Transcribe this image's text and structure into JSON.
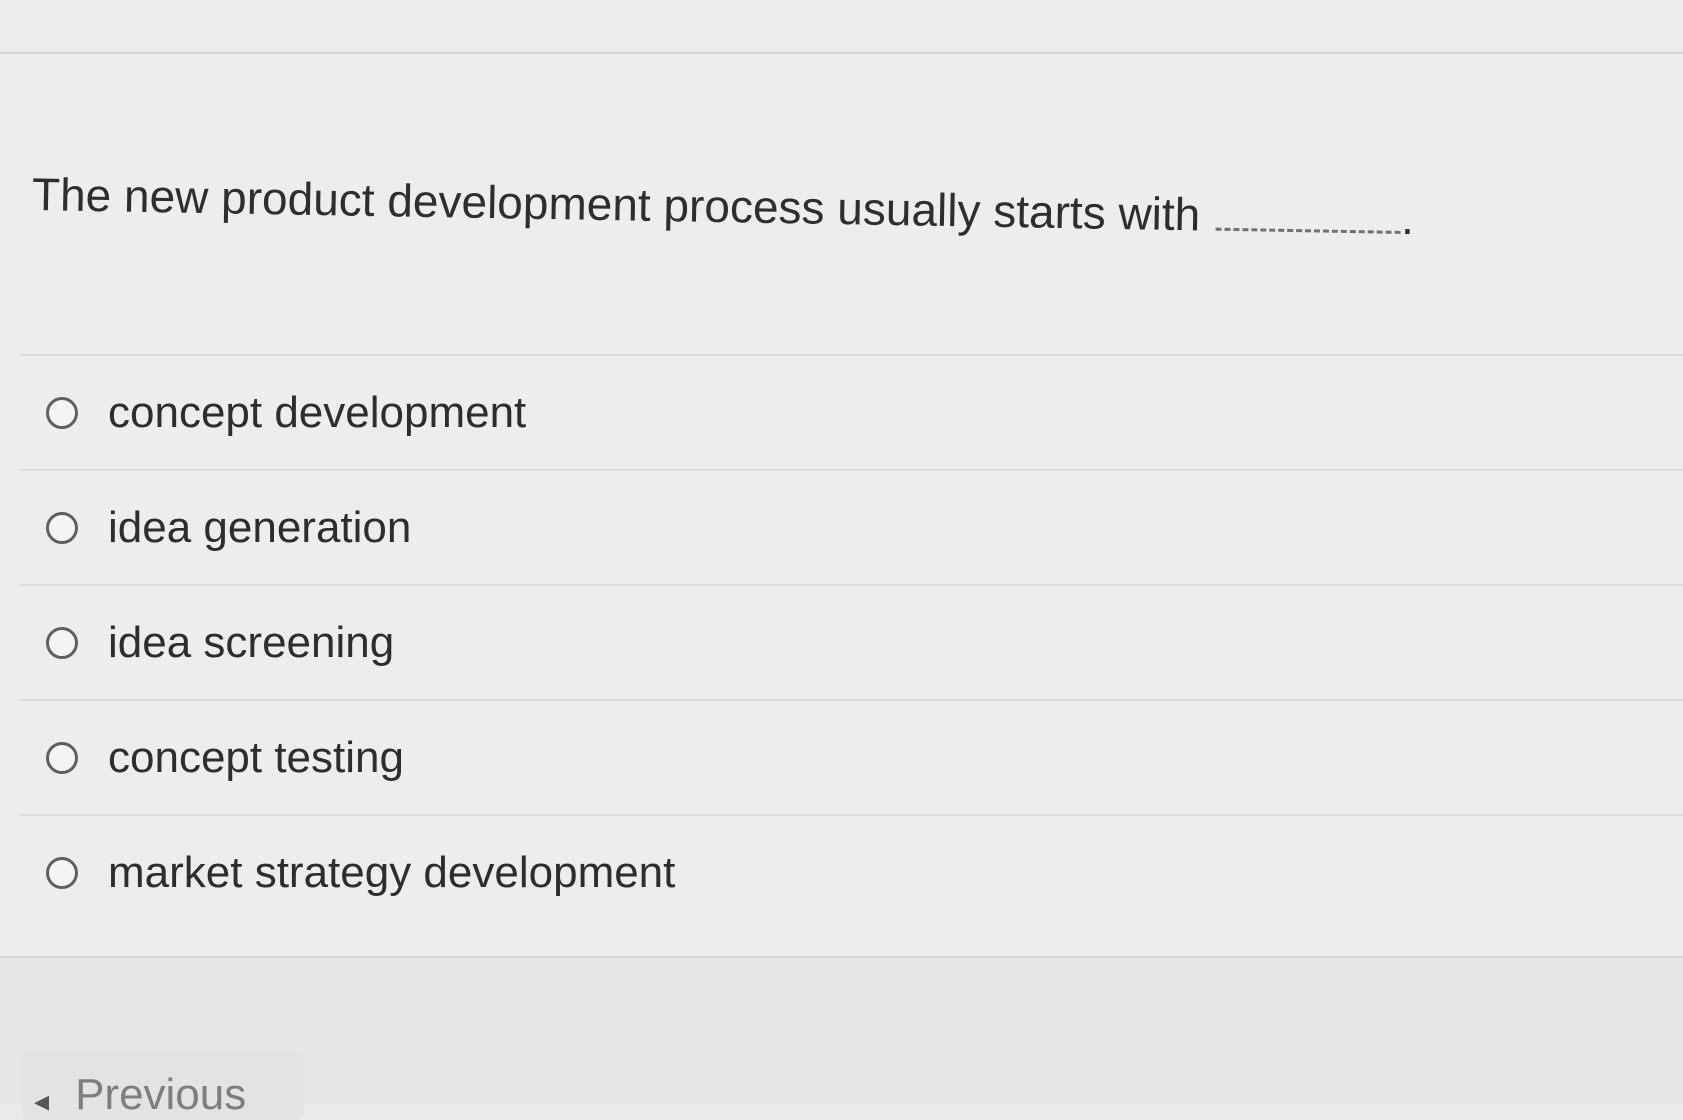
{
  "question": {
    "text": "The new product development process usually starts with"
  },
  "answers": [
    {
      "label": "concept development"
    },
    {
      "label": "idea generation"
    },
    {
      "label": "idea screening"
    },
    {
      "label": "concept testing"
    },
    {
      "label": "market strategy development"
    }
  ],
  "navigation": {
    "previous_label": "Previous",
    "previous_icon": "chevron-left-icon"
  }
}
